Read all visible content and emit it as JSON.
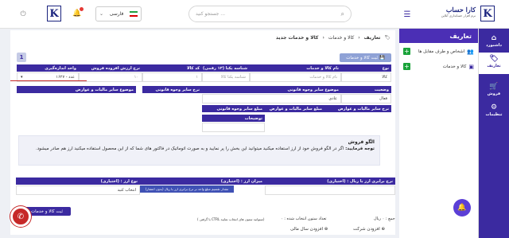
{
  "topbar": {
    "search_placeholder": "جستجو کنید ...",
    "language": "فارسی",
    "brand_title": "کارا حساب",
    "brand_subtitle": "نرم افزار حسابداری آنلاین",
    "logo_letter": "K",
    "menu_icon": "hamburger-icon",
    "notification_count_shown": true
  },
  "rnav": {
    "items": [
      {
        "label": "داشبورد",
        "icon": "home-icon"
      },
      {
        "label": "تعاریف",
        "icon": "tag-icon"
      },
      {
        "label": "فروش",
        "icon": "cart-icon"
      },
      {
        "label": "تنظیمات",
        "icon": "gear-icon"
      }
    ]
  },
  "subpanel": {
    "title": "تعاریف",
    "items": [
      {
        "label": "اشخاص و طرف مقابل ها"
      },
      {
        "label": "کالا و خدمات"
      }
    ]
  },
  "breadcrumb": {
    "root": "تعاریف",
    "mid": "کالا و خدمات",
    "current": "کالا و خدمات جدید"
  },
  "toolbar": {
    "save_label": "ثبت کالا و خدمات",
    "tab_number": "1"
  },
  "form": {
    "headers1": [
      "نوع",
      "نام کالا و خدمات",
      "شناسه یکتا (۱۳ رقمی)",
      "کد کالا",
      "نرخ ارزش افزوده فروش",
      "واحد اندازه‌گیری"
    ],
    "row1": {
      "type": "کالا",
      "name_placeholder": "نام کالا و خدمات",
      "barcode_placeholder": "شناسه یکتا کالا",
      "code": "۱",
      "vat_rate": "۱۰",
      "unit": "۱۶۲۷ - عدد"
    },
    "headers2": [
      "وضعیت",
      "موضوع سایر وجوه قانونی",
      "نرخ سایر وجوه قانونی",
      "موضوع سایر مالیات و عوارض"
    ],
    "row2": {
      "status": "فعال",
      "subject": "عادی"
    },
    "headers3": [
      "نرخ سایر مالیات و عوارض",
      "مبلغ سایر مالیات و عوارض",
      "مبلغ سایر وجوه قانونی"
    ],
    "desc_header": "توضیحات"
  },
  "info": {
    "title": "الگو فروش",
    "note_label": "توجه فرمایید:",
    "note_text": "اگر در الگو فروش خود از ارز استفاده میکنید میتوانید این بخش را پر نمایید و به صورت اتوماتیک در فاکتور های شما که از این محصول استفاده میکنید ارز هم صادر میشود."
  },
  "currency": {
    "headers": [
      "نرخ برابری ارز با ریال : (اختیاری)",
      "میزان ارز : (اختیاری)",
      "نوع ارز : (اختیاری)"
    ],
    "select_value": "انتخاب کنید",
    "tooltip": "مقدار تقسیم مبلغ واحد بر نرخ برابری ارز با ریال (بدون اعشار)"
  },
  "bottom": {
    "save_label": "ثبت کالا و خدمات",
    "footer_sum": "جمع : ۰ ریال",
    "footer_count": "تعداد ستون انتخاب شده : ۰",
    "footer_hint": "( با گرفتن CTRL میتوانید ستون های انتخاب نمایید)",
    "add_company": "افزودن شرکت",
    "add_fiscal_year": "افزودن سال مالی"
  },
  "colors": {
    "primary": "#3b2aa0",
    "accent": "#4b2fb5",
    "alert": "#c62828",
    "success": "#1aa33a"
  }
}
